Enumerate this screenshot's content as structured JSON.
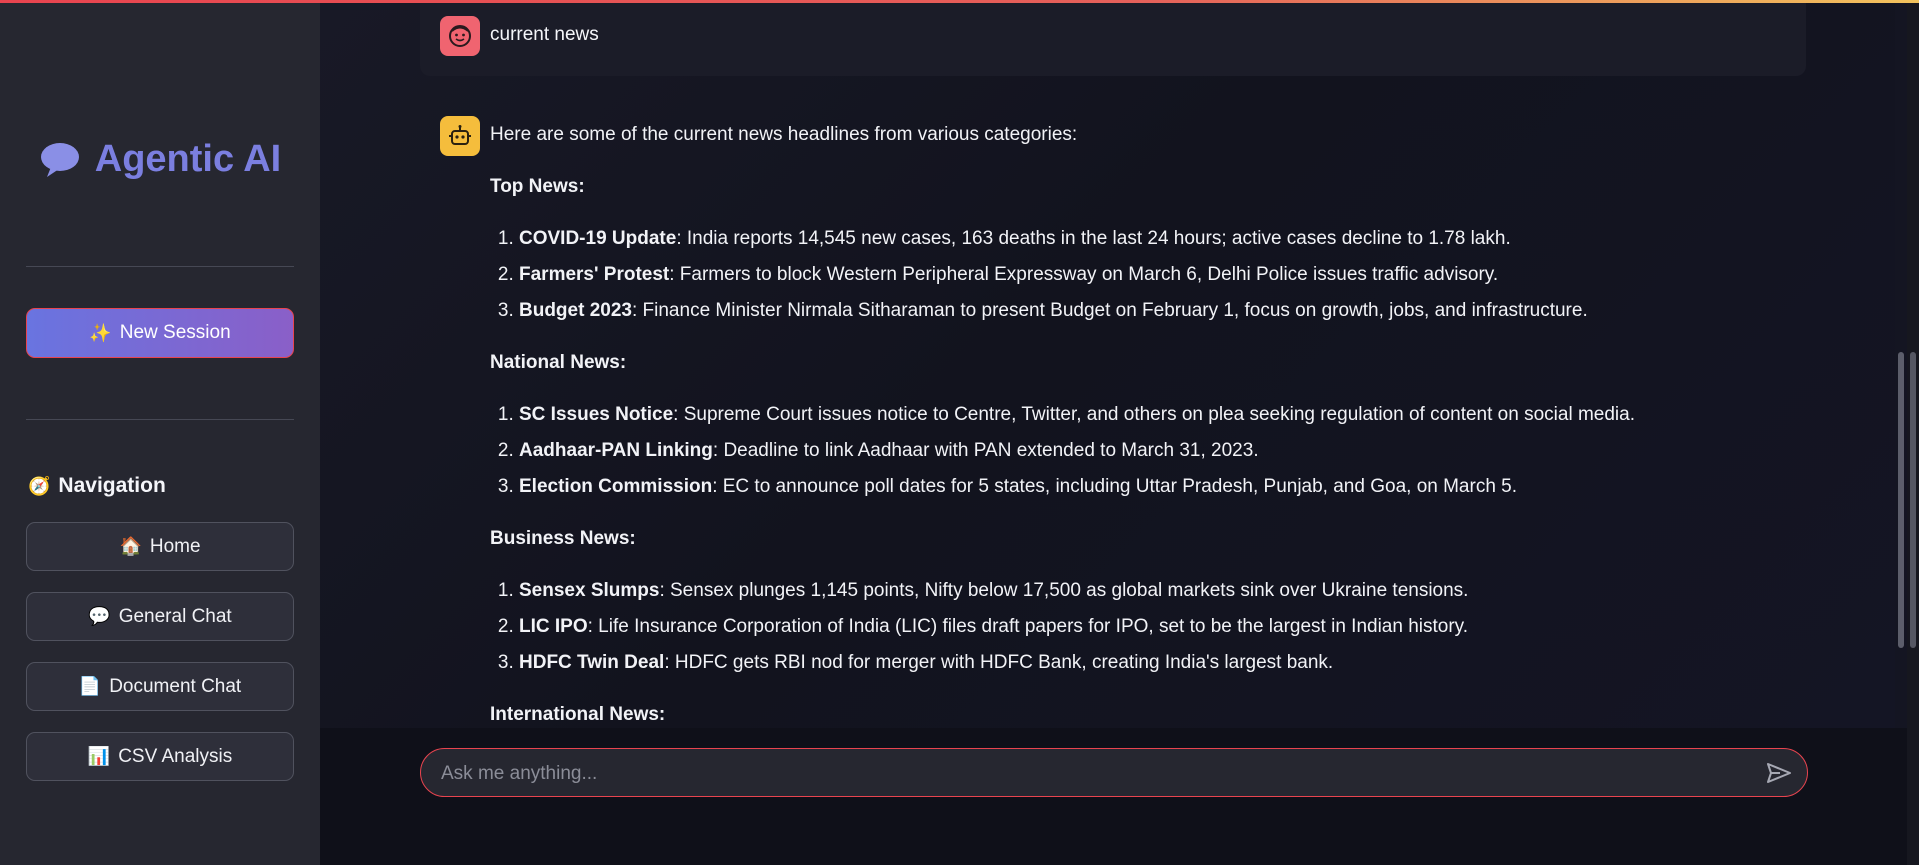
{
  "sidebar": {
    "brand_emoji": "💬",
    "brand_title": "Agentic AI",
    "new_session": {
      "icon": "✨",
      "label": "New Session"
    },
    "navigation_title": "Navigation",
    "navigation_icon": "🧭",
    "nav_items": [
      {
        "icon": "🏠",
        "label": "Home"
      },
      {
        "icon": "💬",
        "label": "General Chat"
      },
      {
        "icon": "📄",
        "label": "Document Chat"
      },
      {
        "icon": "📊",
        "label": "CSV Analysis"
      }
    ]
  },
  "chat": {
    "user_message": "current news",
    "assistant": {
      "intro": "Here are some of the current news headlines from various categories:",
      "sections": [
        {
          "title": "Top News:",
          "items": [
            {
              "title": "COVID-19 Update",
              "text": ": India reports 14,545 new cases, 163 deaths in the last 24 hours; active cases decline to 1.78 lakh."
            },
            {
              "title": "Farmers' Protest",
              "text": ": Farmers to block Western Peripheral Expressway on March 6, Delhi Police issues traffic advisory."
            },
            {
              "title": "Budget 2023",
              "text": ": Finance Minister Nirmala Sitharaman to present Budget on February 1, focus on growth, jobs, and infrastructure."
            }
          ]
        },
        {
          "title": "National News:",
          "items": [
            {
              "title": "SC Issues Notice",
              "text": ": Supreme Court issues notice to Centre, Twitter, and others on plea seeking regulation of content on social media."
            },
            {
              "title": "Aadhaar-PAN Linking",
              "text": ": Deadline to link Aadhaar with PAN extended to March 31, 2023."
            },
            {
              "title": "Election Commission",
              "text": ": EC to announce poll dates for 5 states, including Uttar Pradesh, Punjab, and Goa, on March 5."
            }
          ]
        },
        {
          "title": "Business News:",
          "items": [
            {
              "title": "Sensex Slumps",
              "text": ": Sensex plunges 1,145 points, Nifty below 17,500 as global markets sink over Ukraine tensions."
            },
            {
              "title": "LIC IPO",
              "text": ": Life Insurance Corporation of India (LIC) files draft papers for IPO, set to be the largest in Indian history."
            },
            {
              "title": "HDFC Twin Deal",
              "text": ": HDFC gets RBI nod for merger with HDFC Bank, creating India's largest bank."
            }
          ]
        },
        {
          "title": "International News:",
          "items": []
        }
      ]
    }
  },
  "input": {
    "placeholder": "Ask me anything..."
  },
  "colors": {
    "accent": "#e8444f",
    "brand": "#7b7fe0",
    "user_avatar": "#f06470",
    "bot_avatar": "#f5bd3c"
  }
}
